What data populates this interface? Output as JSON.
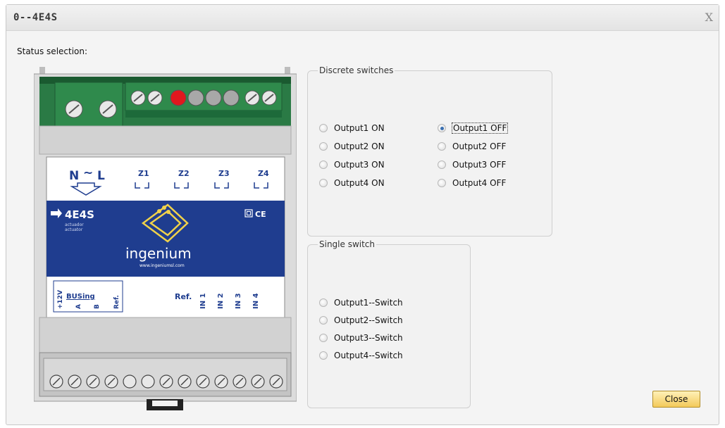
{
  "window": {
    "title": "0--4E4S",
    "close_glyph": "X"
  },
  "status_label": "Status selection:",
  "device": {
    "label_n": "N",
    "label_tilde": "~",
    "label_l": "L",
    "zones": [
      "Z1",
      "Z2",
      "Z3",
      "Z4"
    ],
    "model": "4E4S",
    "sub1": "actuador",
    "sub2": "actuator",
    "ce": "CE",
    "brand": "ingenium",
    "url": "www.ingeniumsl.com",
    "bus_logo": "BUSing",
    "bus_terms": [
      "+12V",
      "A",
      "B",
      "Ref."
    ],
    "ref": "Ref.",
    "inputs": [
      "IN 1",
      "IN 2",
      "IN 3",
      "IN 4"
    ]
  },
  "discrete": {
    "legend": "Discrete switches",
    "left": [
      "Output1 ON",
      "Output2 ON",
      "Output3 ON",
      "Output4 ON"
    ],
    "right": [
      "Output1 OFF",
      "Output2 OFF",
      "Output3 OFF",
      "Output4 OFF"
    ],
    "selected": "Output1 OFF"
  },
  "single": {
    "legend": "Single switch",
    "items": [
      "Output1--Switch",
      "Output2--Switch",
      "Output3--Switch",
      "Output4--Switch"
    ]
  },
  "close_label": "Close",
  "colors": {
    "panel_blue": "#1f3d8f",
    "terminal_green": "#1d6a3a",
    "indicator_red": "#e0181e",
    "button_gold": "#f3c95a"
  }
}
